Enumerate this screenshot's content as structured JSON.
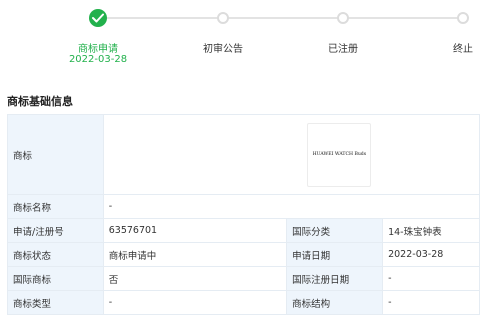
{
  "progress": {
    "steps": [
      {
        "label": "商标申请",
        "date": "2022-03-28",
        "status": "done"
      },
      {
        "label": "初审公告",
        "status": "pending"
      },
      {
        "label": "已注册",
        "status": "pending"
      },
      {
        "label": "终止",
        "status": "pending"
      }
    ],
    "colors": {
      "done": "#22b14c",
      "pending": "#dcdcdc"
    }
  },
  "section": {
    "title": "商标基础信息"
  },
  "table": {
    "image_label": "商标",
    "logo_text": "HUAWEI WATCH Buds",
    "name_label": "商标名称",
    "name_value": "-",
    "rows": [
      {
        "k1": "申请/注册号",
        "v1": "63576701",
        "k2": "国际分类",
        "v2": "14-珠宝钟表"
      },
      {
        "k1": "商标状态",
        "v1": "商标申请中",
        "k2": "申请日期",
        "v2": "2022-03-28"
      },
      {
        "k1": "国际商标",
        "v1": "否",
        "k2": "国际注册日期",
        "v2": "-"
      },
      {
        "k1": "商标类型",
        "v1": "-",
        "k2": "商标结构",
        "v2": "-"
      }
    ]
  }
}
